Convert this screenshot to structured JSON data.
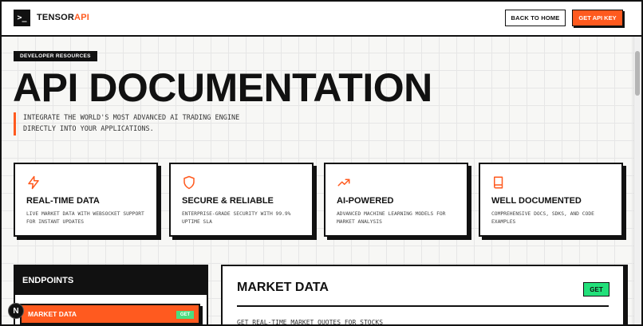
{
  "header": {
    "logo_glyph": ">_",
    "brand_main": "TENSOR",
    "brand_accent": "API",
    "back_home_label": "BACK TO HOME",
    "get_key_label": "GET API KEY"
  },
  "hero": {
    "badge": "DEVELOPER RESOURCES",
    "title": "API DOCUMENTATION",
    "tagline_line1": "INTEGRATE THE WORLD'S MOST ADVANCED AI TRADING ENGINE",
    "tagline_line2": "DIRECTLY INTO YOUR APPLICATIONS."
  },
  "features": [
    {
      "icon": "lightning-icon",
      "title": "REAL-TIME DATA",
      "desc": "LIVE MARKET DATA WITH WEBSOCKET SUPPORT FOR INSTANT UPDATES"
    },
    {
      "icon": "shield-icon",
      "title": "SECURE & RELIABLE",
      "desc": "ENTERPRISE-GRADE SECURITY WITH 99.9% UPTIME SLA"
    },
    {
      "icon": "trending-up-icon",
      "title": "AI-POWERED",
      "desc": "ADVANCED MACHINE LEARNING MODELS FOR MARKET ANALYSIS"
    },
    {
      "icon": "book-icon",
      "title": "WELL DOCUMENTED",
      "desc": "COMPREHENSIVE DOCS, SDKS, AND CODE EXAMPLES"
    }
  ],
  "sidebar": {
    "heading": "ENDPOINTS",
    "items": [
      {
        "label": "MARKET DATA",
        "method": "GET"
      }
    ]
  },
  "panel": {
    "title": "MARKET DATA",
    "method": "GET",
    "description": "GET REAL-TIME MARKET QUOTES FOR STOCKS"
  },
  "fab": {
    "label": "N"
  },
  "colors": {
    "accent": "#ff5a1f",
    "ink": "#111111",
    "get_green": "#22e07a"
  }
}
